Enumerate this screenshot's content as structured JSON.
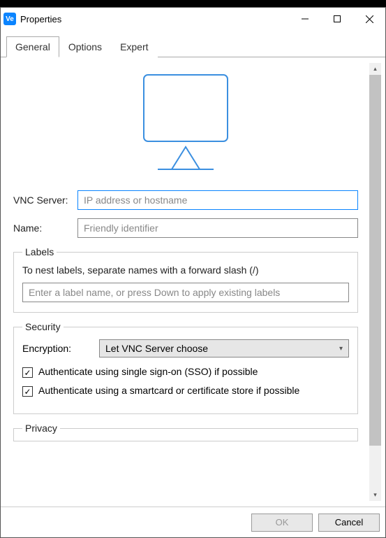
{
  "window": {
    "title": "Properties"
  },
  "tabs": {
    "general": "General",
    "options": "Options",
    "expert": "Expert",
    "active": "general"
  },
  "form": {
    "vnc_server_label": "VNC Server:",
    "vnc_server_placeholder": "IP address or hostname",
    "vnc_server_value": "",
    "name_label": "Name:",
    "name_placeholder": "Friendly identifier",
    "name_value": ""
  },
  "labels_group": {
    "legend": "Labels",
    "hint": "To nest labels, separate names with a forward slash (/)",
    "input_placeholder": "Enter a label name, or press Down to apply existing labels",
    "input_value": ""
  },
  "security_group": {
    "legend": "Security",
    "encryption_label": "Encryption:",
    "encryption_value": "Let VNC Server choose",
    "sso_checked": true,
    "sso_label": "Authenticate using single sign-on (SSO) if possible",
    "smartcard_checked": true,
    "smartcard_label": "Authenticate using a smartcard or certificate store if possible"
  },
  "privacy_group": {
    "legend": "Privacy"
  },
  "footer": {
    "ok": "OK",
    "cancel": "Cancel"
  },
  "icons": {
    "app_glyph": "Ve",
    "check": "✓"
  }
}
